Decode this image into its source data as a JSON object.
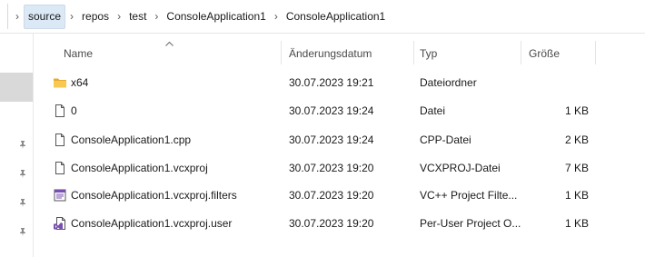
{
  "breadcrumb": {
    "items": [
      "source",
      "repos",
      "test",
      "ConsoleApplication1",
      "ConsoleApplication1"
    ],
    "separator": "›"
  },
  "columns": {
    "name": "Name",
    "date": "Änderungsdatum",
    "type": "Typ",
    "size": "Größe"
  },
  "files": [
    {
      "name": "x64",
      "date": "30.07.2023 19:21",
      "type": "Dateiordner",
      "size": "",
      "icon": "folder-icon"
    },
    {
      "name": "0",
      "date": "30.07.2023 19:24",
      "type": "Datei",
      "size": "1 KB",
      "icon": "file-icon"
    },
    {
      "name": "ConsoleApplication1.cpp",
      "date": "30.07.2023 19:24",
      "type": "CPP-Datei",
      "size": "2 KB",
      "icon": "file-icon"
    },
    {
      "name": "ConsoleApplication1.vcxproj",
      "date": "30.07.2023 19:20",
      "type": "VCXPROJ-Datei",
      "size": "7 KB",
      "icon": "file-icon"
    },
    {
      "name": "ConsoleApplication1.vcxproj.filters",
      "date": "30.07.2023 19:20",
      "type": "VC++ Project Filte...",
      "size": "1 KB",
      "icon": "filters-icon"
    },
    {
      "name": "ConsoleApplication1.vcxproj.user",
      "date": "30.07.2023 19:20",
      "type": "Per-User Project O...",
      "size": "1 KB",
      "icon": "vs-user-icon"
    }
  ],
  "colors": {
    "breadcrumb_active_bg": "#dbe8f6",
    "folder": "#f2c14e",
    "vs_purple": "#7a4fb3"
  }
}
